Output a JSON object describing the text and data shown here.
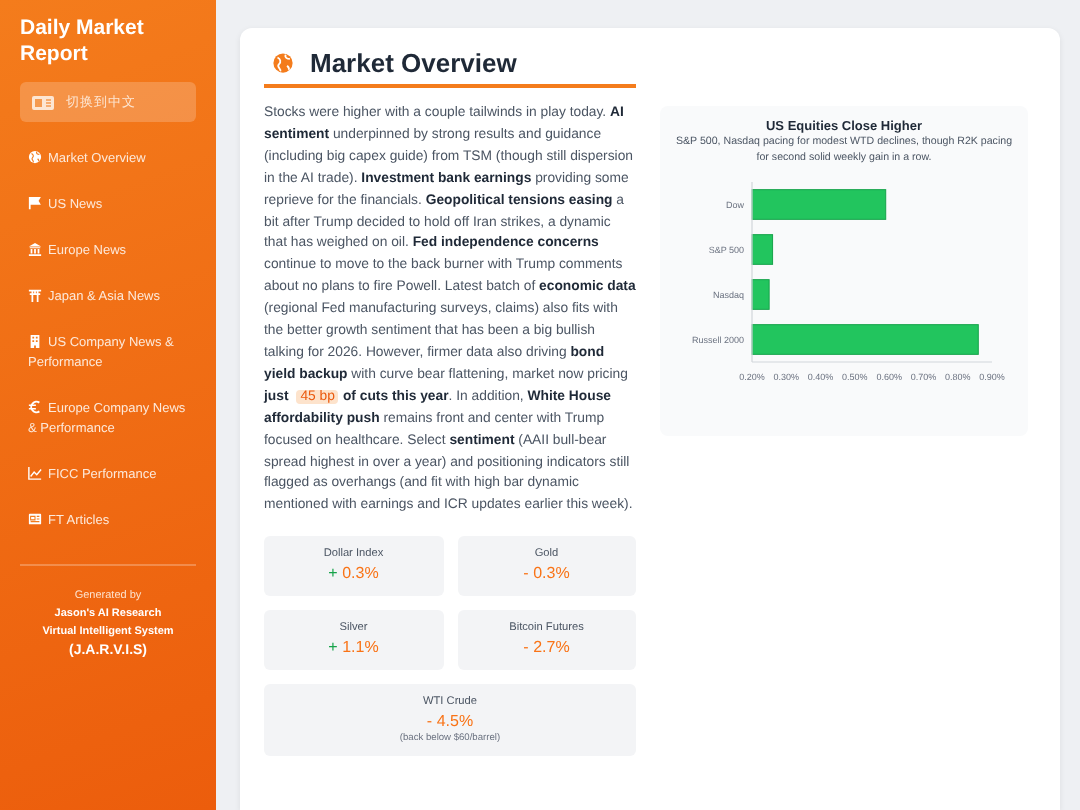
{
  "sidebar": {
    "title": "Daily Market Report",
    "language_button": "切换到中文",
    "items": [
      {
        "label": "Market Overview"
      },
      {
        "label": "US News"
      },
      {
        "label": "Europe News"
      },
      {
        "label": "Japan & Asia News"
      },
      {
        "label": "US Company News & Performance"
      },
      {
        "label": "Europe Company News & Performance"
      },
      {
        "label": "FICC Performance"
      },
      {
        "label": "FT Articles"
      }
    ],
    "footer": [
      "Generated by",
      "Jason's AI Research",
      "Virtual Intelligent System",
      "(J.A.R.V.I.S)"
    ]
  },
  "main": {
    "title": "Market Overview",
    "summary": [
      {
        "kind": "text",
        "text": "Stocks were higher with a couple tailwinds in play today. **AI sentiment** underpinned by strong results and guidance (including big capex guide) from TSM (though still dispersion in the AI trade). **Investment bank earnings** providing some reprieve for the financials. **Geopolitical tensions easing** a bit after Trump decided to hold off Iran strikes, a dynamic that has weighed on oil. **Fed independence concerns** continue to move to the back burner with Trump comments about no plans to fire Powell. Latest batch of **economic data** (regional Fed manufacturing surveys, claims) also fits with the better growth sentiment that has been a big bullish talking for 2026. However, firmer data also driving **bond yield backup** with curve bear flattening, market now pricing **just**"
      },
      {
        "kind": "highlight",
        "text": "45 bp"
      },
      {
        "kind": "text",
        "text": "**of cuts this year**. In addition, **White House affordability push** remains front and center with Trump focused on healthcare. Select **sentiment** (AAII bull-bear spread highest in over a year) and positioning indicators still flagged as overhangs (and fit with high bar dynamic mentioned with earnings and ICR updates earlier this week)."
      }
    ],
    "markets": [
      {
        "name": "Dollar Index",
        "sign": "+",
        "kind": "gain",
        "value": "0.3%"
      },
      {
        "name": "Gold",
        "sign": "-",
        "kind": "loss",
        "value": "0.3%"
      },
      {
        "name": "Silver",
        "sign": "+",
        "kind": "gain",
        "value": "1.1%"
      },
      {
        "name": "Bitcoin Futures",
        "sign": "-",
        "kind": "loss",
        "value": "2.7%"
      },
      {
        "name": "WTI Crude",
        "sign": "-",
        "kind": "loss",
        "value": "4.5%",
        "note": "(back below $60/barrel)"
      }
    ],
    "chart": {
      "chart_data": {
        "type": "bar",
        "orientation": "horizontal",
        "title": "US Equities Close Higher",
        "subtitle": "S&P 500, Nasdaq pacing for modest WTD declines, though R2K pacing for second solid weekly gain in a row.",
        "categories": [
          "Dow",
          "S&P 500",
          "Nasdaq",
          "Russell 2000"
        ],
        "series": [
          {
            "color": "#22c55e",
            "values": [
              0.59,
              0.26,
              0.25,
              0.86
            ]
          }
        ],
        "xlim": [
          0.2,
          0.9
        ],
        "xticks": [
          {
            "value": 0.2,
            "label": "0.20%"
          },
          {
            "value": 0.3,
            "label": "0.30%"
          },
          {
            "value": 0.4,
            "label": "0.40%"
          },
          {
            "value": 0.5,
            "label": "0.50%"
          },
          {
            "value": 0.6,
            "label": "0.60%"
          },
          {
            "value": 0.7,
            "label": "0.70%"
          },
          {
            "value": 0.8,
            "label": "0.80%"
          },
          {
            "value": 0.9,
            "label": "0.90%"
          }
        ]
      }
    }
  }
}
